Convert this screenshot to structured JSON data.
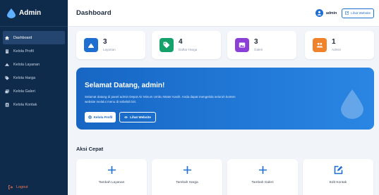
{
  "brand": {
    "label": "Admin",
    "icon": "water-drop-icon"
  },
  "sidebar": {
    "items": [
      {
        "label": "Dashboard",
        "icon": "home-icon",
        "active": true
      },
      {
        "label": "Kelola Profil",
        "icon": "building-icon",
        "active": false
      },
      {
        "label": "Kelola Layanan",
        "icon": "truck-icon",
        "active": false
      },
      {
        "label": "Kelola Harga",
        "icon": "tag-icon",
        "active": false
      },
      {
        "label": "Kelola Galeri",
        "icon": "images-icon",
        "active": false
      },
      {
        "label": "Kelola Kontak",
        "icon": "contact-book-icon",
        "active": false
      }
    ],
    "logout": "Logout"
  },
  "header": {
    "title": "Dashboard",
    "user": "admin",
    "view_site": "Lihat Website"
  },
  "stats": [
    {
      "value": "3",
      "label": "Layanan",
      "color": "#1f6fd0",
      "icon": "truck-icon"
    },
    {
      "value": "4",
      "label": "Daftar Harga",
      "color": "#16a06a",
      "icon": "tag-icon"
    },
    {
      "value": "3",
      "label": "Galeri",
      "color": "#8b3fd6",
      "icon": "image-icon"
    },
    {
      "value": "1",
      "label": "Admin",
      "color": "#f0822a",
      "icon": "users-icon"
    }
  ],
  "banner": {
    "title": "Selamat Datang, admin!",
    "description": "Selamat datang di panel admin Depot Air Minum Umbu Water Kasih. Anda dapat mengelola seluruh konten website melalui menu di sebelah kiri.",
    "btn_profile": "Kelola Profil",
    "btn_site": "Lihat Website"
  },
  "quick": {
    "title": "Aksi Cepat",
    "items": [
      {
        "label": "Tambah Layanan",
        "icon": "plus-icon"
      },
      {
        "label": "Tambah Harga",
        "icon": "plus-icon"
      },
      {
        "label": "Tambah Galeri",
        "icon": "plus-icon"
      },
      {
        "label": "Edit Kontak",
        "icon": "edit-icon"
      }
    ]
  },
  "colors": {
    "sidebar": "#0f2b4c",
    "accent": "#1f6fd0",
    "logout": "#f27a50"
  }
}
